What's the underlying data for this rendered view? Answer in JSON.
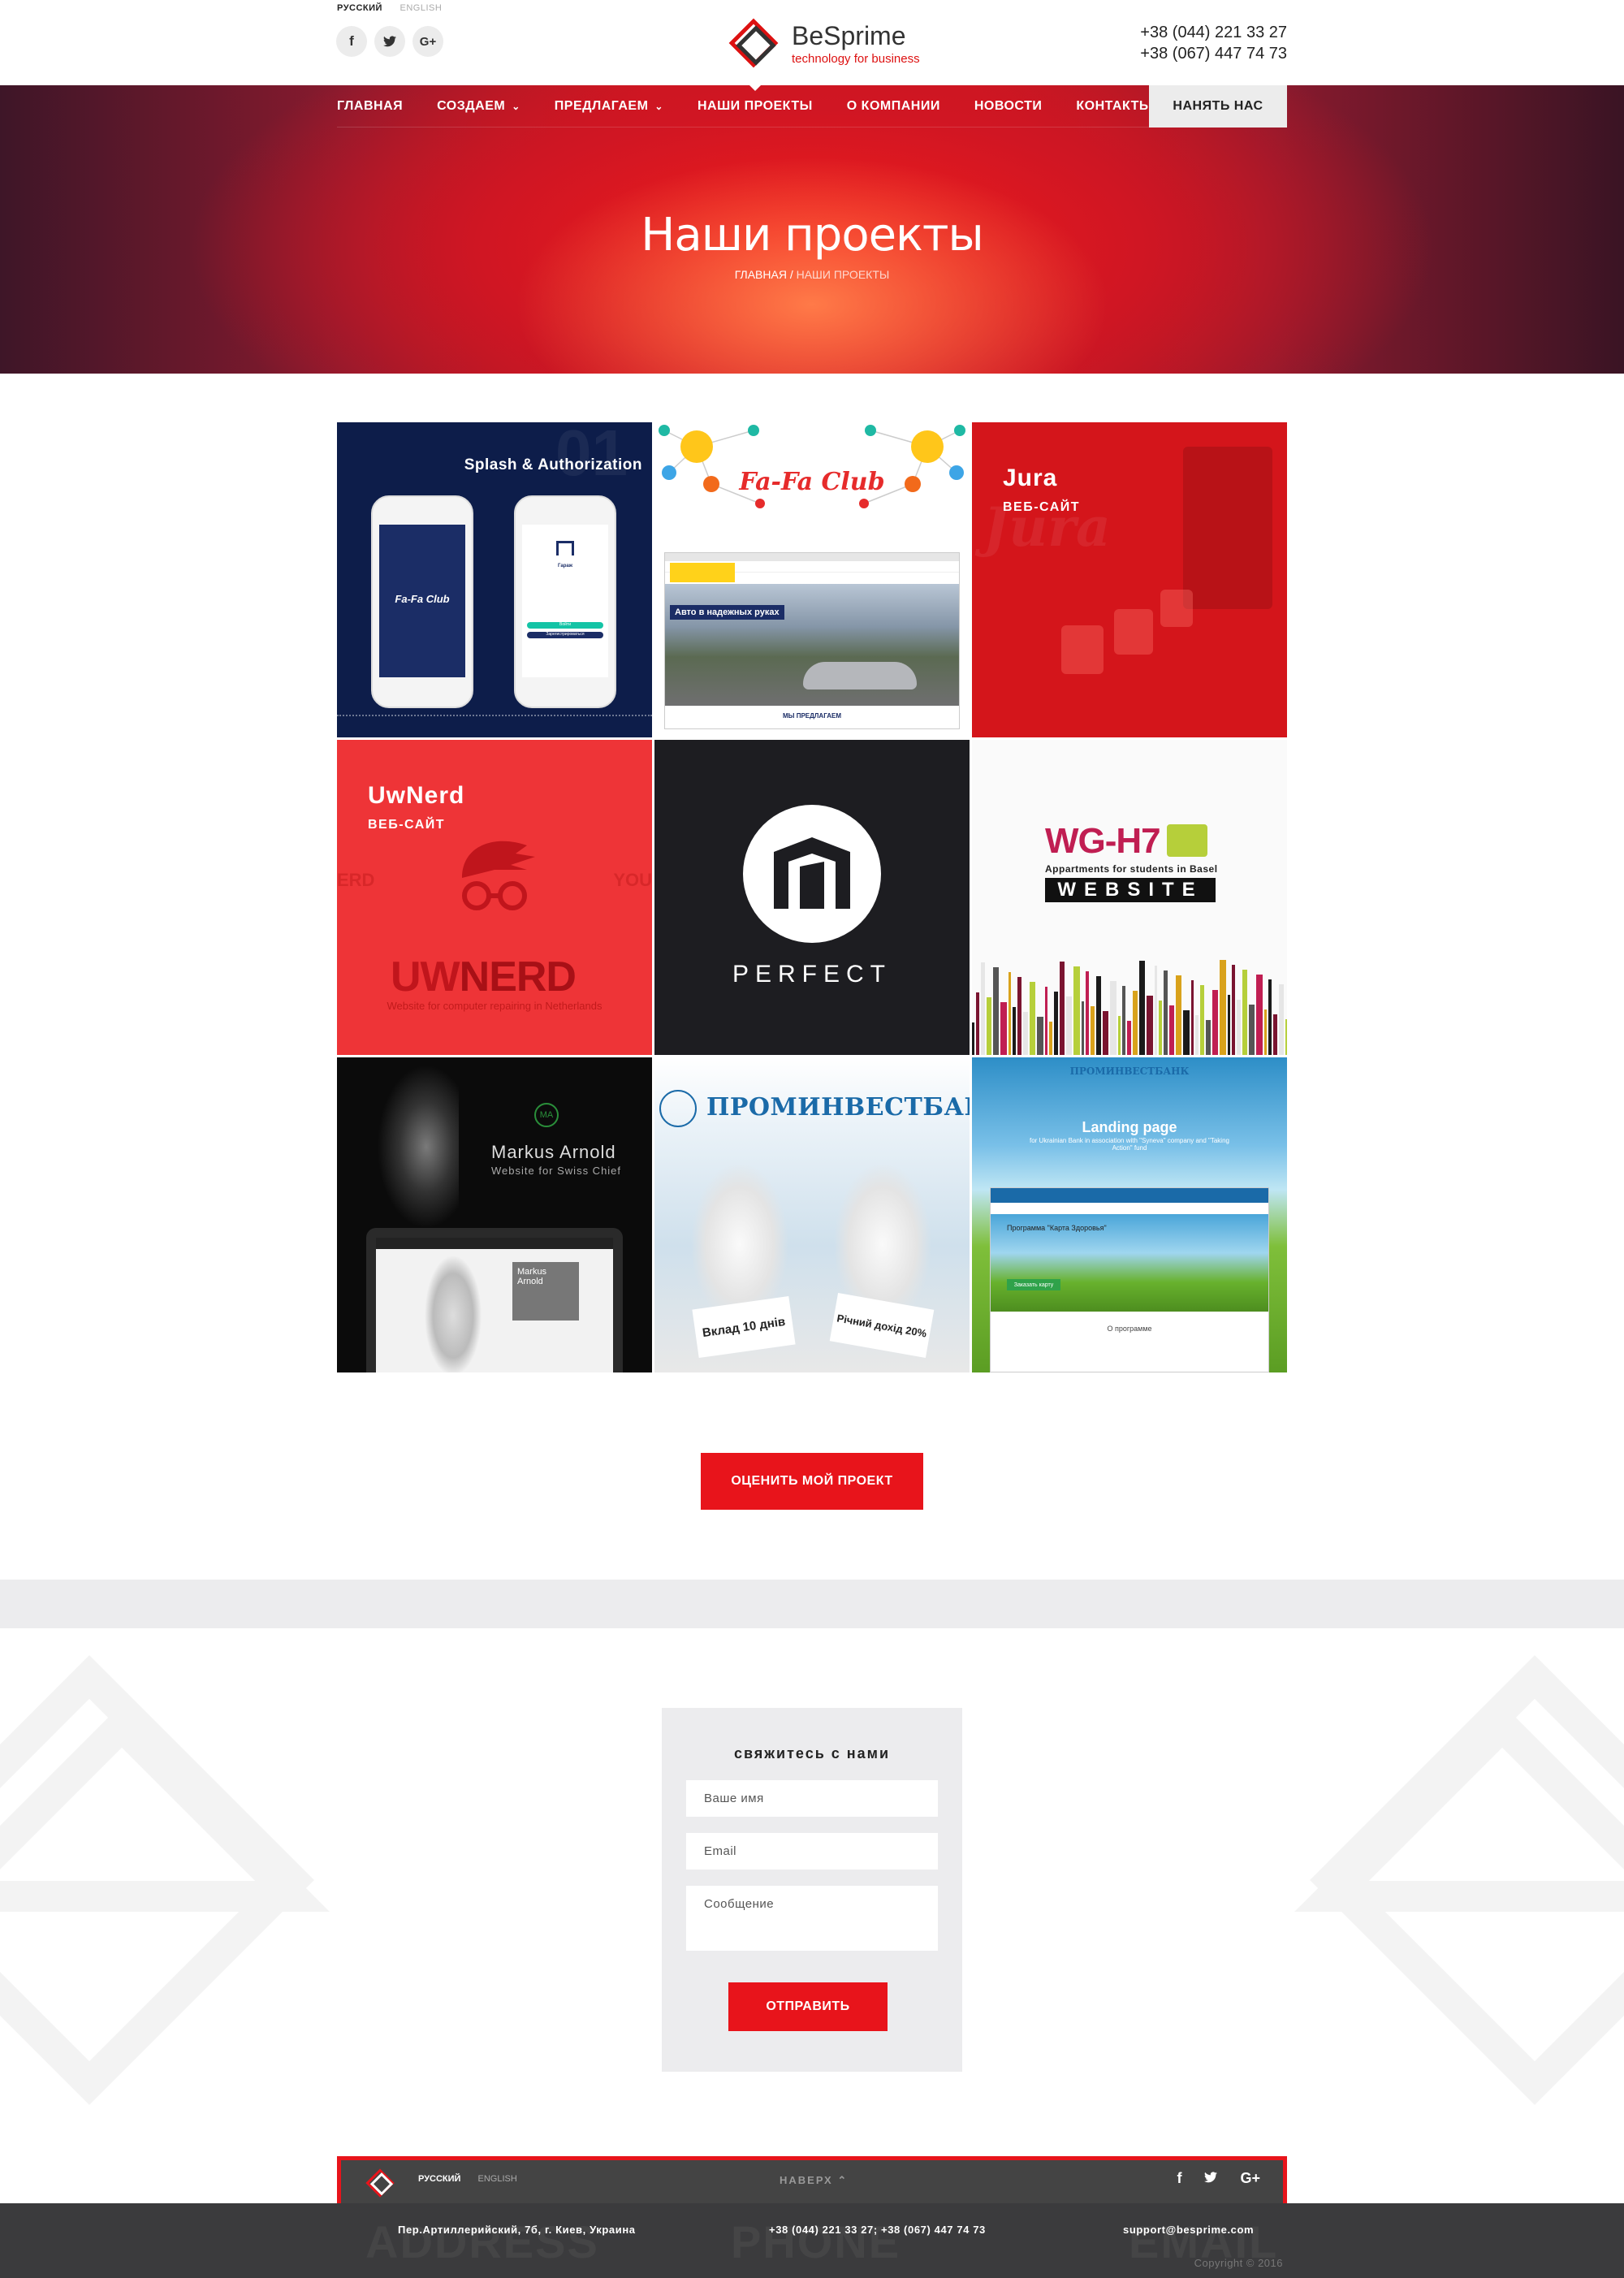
{
  "header": {
    "lang_active": "РУССКИЙ",
    "lang_other": "ENGLISH",
    "socials": [
      "f",
      "t",
      "G+"
    ],
    "logo_name": "BeSprime",
    "logo_tagline": "technology for business",
    "phone1": "+38 (044) 221 33 27",
    "phone2": "+38 (067) 447 74 73"
  },
  "nav": {
    "items": [
      "ГЛАВНАЯ",
      "СОЗДАЕМ",
      "ПРЕДЛАГАЕМ",
      "НАШИ ПРОЕКТЫ",
      "О КОМПАНИИ",
      "НОВОСТИ",
      "КОНТАКТЫ"
    ],
    "hire_label": "НАНЯТЬ НАС"
  },
  "hero": {
    "title": "Наши проекты",
    "crumb_home": "ГЛАВНАЯ",
    "crumb_sep": "/",
    "crumb_current": "НАШИ ПРОЕКТЫ"
  },
  "projects": [
    {
      "title": "Splash & Authorization",
      "brand": "Fa-Fa Club",
      "phone_title": "Гараж",
      "phone_btn1": "Войти",
      "phone_btn2": "Зарегистрироваться",
      "bignum": "01"
    },
    {
      "brand": "Fa-Fa Club",
      "banner": "Авто в надежных руках",
      "section": "МЫ ПРЕДЛАГАЕМ"
    },
    {
      "title": "Jura",
      "subtitle": "ВЕБ-САЙТ",
      "brand": "Jura"
    },
    {
      "title": "UwNerd",
      "subtitle": "ВЕБ-САЙТ",
      "logo_a": "UW",
      "logo_b": "NERD",
      "caption": "Website for computer repairing in Netherlands",
      "side_left": "ERD",
      "side_right": "YOU"
    },
    {
      "caption": "PERFECT"
    },
    {
      "logo": "WG-H7",
      "tagline": "Appartments for students in Basel",
      "caption": "WEBSITE"
    },
    {
      "name": "Markus Arnold",
      "caption": "Website for Swiss Chief",
      "monogram": "MA",
      "panel": "Markus Arnold"
    },
    {
      "bank": "ПРОМИНВЕСТБАНК",
      "card1": "Вклад 10 днів",
      "card2": "Річний дохід 20%"
    },
    {
      "bank": "ПРОМИНВЕСТБАНК",
      "title": "Landing page",
      "caption": "for Ukrainian Bank in association with \"Syneva\" company and \"Taking Action\" fund",
      "program": "Программа \"Карта Здоровья\"",
      "button": "Заказать карту",
      "about": "О программе"
    }
  ],
  "cta_label": "ОЦЕНИТЬ МОЙ ПРОЕКТ",
  "contact": {
    "title": "свяжитесь с нами",
    "name_placeholder": "Ваше имя",
    "email_placeholder": "Email",
    "message_placeholder": "Сообщение",
    "send_label": "ОТПРАВИТЬ"
  },
  "footer": {
    "lang_active": "РУССКИЙ",
    "lang_other": "ENGLISH",
    "to_top": "НАВЕРХ",
    "address": "Пер.Артиллерийский, 7б, г. Киев, Украина",
    "phones": "+38 (044) 221 33 27; +38 (067) 447 74 73",
    "email": "support@besprime.com",
    "copyright": "Copyright © 2016",
    "ghost_address": "ADDRESS",
    "ghost_phone": "PHONE",
    "ghost_email": "EMAIL"
  },
  "colors": {
    "accent": "#e8141b",
    "dark": "#3b3b3d",
    "light_gray": "#ececee"
  }
}
